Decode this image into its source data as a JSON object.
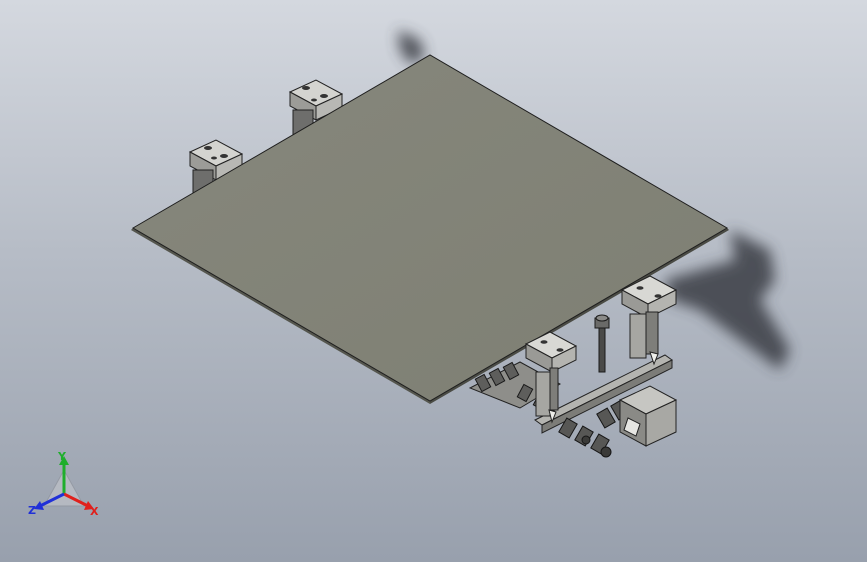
{
  "viewport": {
    "background_top": "#d4d8df",
    "background_bottom": "#98a0ad"
  },
  "model": {
    "plate_color": "#848578",
    "hardware_color": "#b9b9b6"
  },
  "triad": {
    "x_label": "X",
    "y_label": "Y",
    "z_label": "Z",
    "x_color": "#e0201c",
    "y_color": "#1fae2c",
    "z_color": "#2030d8"
  }
}
